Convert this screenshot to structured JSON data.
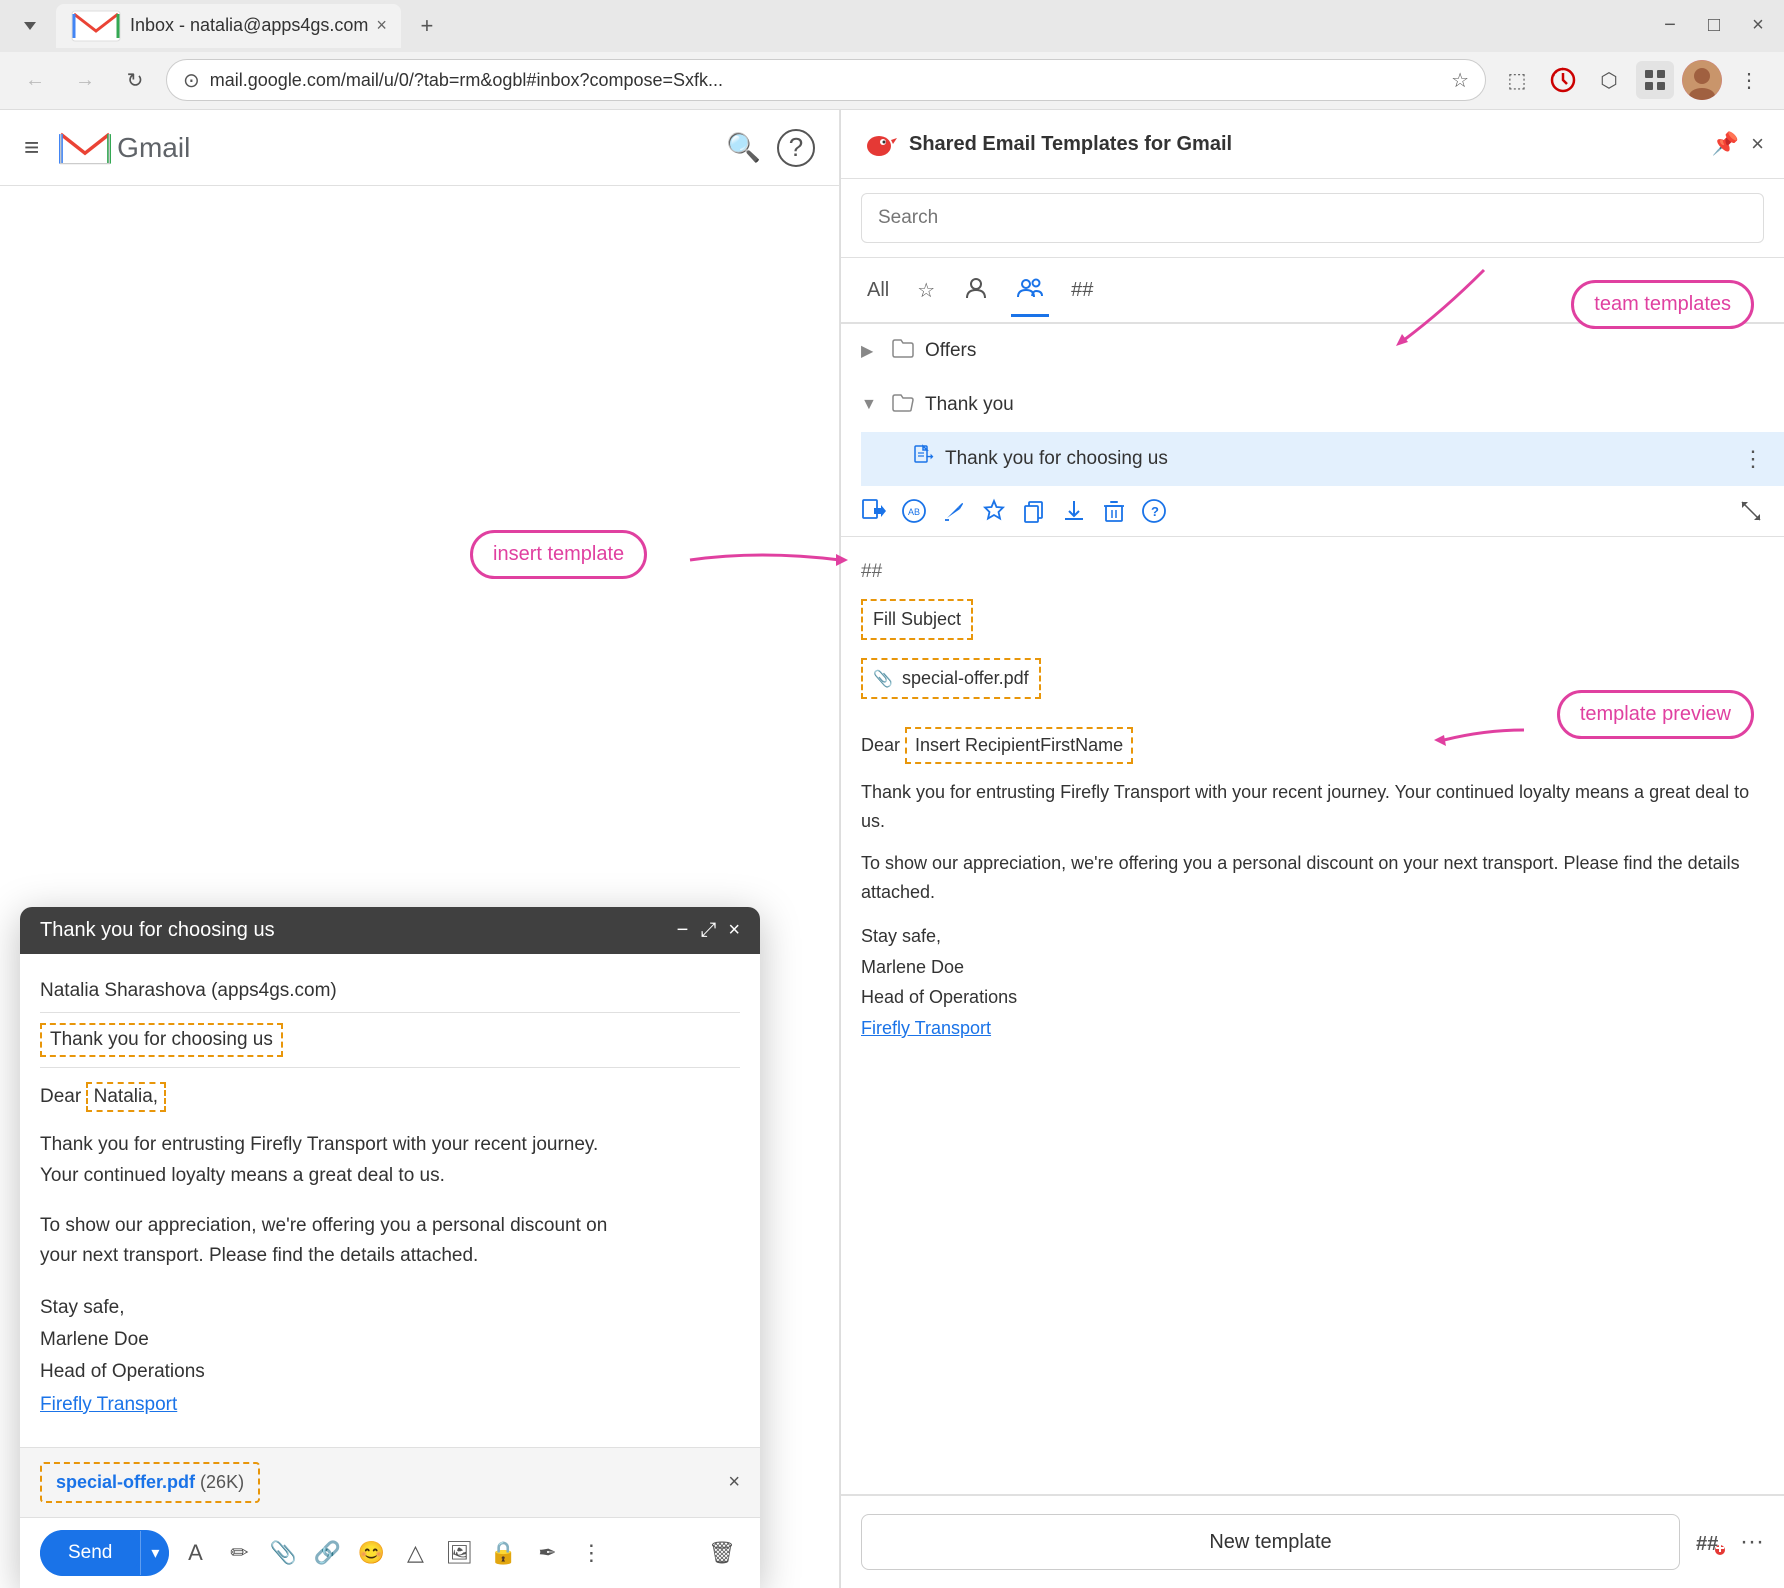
{
  "browser": {
    "tab_title": "Inbox - natalia@apps4gs.com",
    "tab_close": "×",
    "tab_new": "+",
    "url": "mail.google.com/mail/u/0/?tab=rm&ogbl#inbox?compose=Sxfk...",
    "back_icon": "←",
    "forward_icon": "→",
    "refresh_icon": "↻",
    "address_icon": "⊙",
    "bookmark_icon": "☆",
    "cast_icon": "⬚",
    "extensions_icon": "⬡",
    "more_icon": "⋮",
    "window_min": "−",
    "window_max": "□",
    "window_close": "×"
  },
  "gmail": {
    "header": {
      "hamburger": "≡",
      "logo_text": "Gmail",
      "search_icon": "🔍",
      "help_icon": "?"
    }
  },
  "compose": {
    "title": "Thank you for choosing us",
    "minimize_icon": "−",
    "resize_icon": "⤢",
    "close_icon": "×",
    "from": "Natalia Sharashova (apps4gs.com)",
    "subject": "Thank you for choosing us",
    "greeting": "Dear",
    "name_highlight": "Natalia,",
    "body_1": "Thank you for entrusting Firefly Transport with your recent journey.\nYour continued loyalty means a great deal to us.",
    "body_2": "To show our appreciation, we're offering you a personal discount on\nyour next transport. Please find the details attached.",
    "sig_1": "Stay safe,",
    "sig_2": "Marlene Doe",
    "sig_3": "Head of Operations",
    "sig_link": "Firefly Transport",
    "attachment_name": "special-offer.pdf",
    "attachment_size": "(26K)",
    "send_label": "Send",
    "toolbar": {
      "format_icon": "A",
      "highlight_icon": "✏",
      "clip_icon": "📎",
      "link_icon": "🔗",
      "emoji_icon": "😊",
      "drive_icon": "△",
      "image_icon": "🖼",
      "lock_icon": "🔒",
      "pen_icon": "✒",
      "more_icon": "⋮",
      "delete_icon": "🗑"
    }
  },
  "extension": {
    "header": {
      "title": "Shared Email Templates for Gmail",
      "pin_icon": "📌",
      "close_icon": "×"
    },
    "search": {
      "placeholder": "Search"
    },
    "tabs": {
      "all_label": "All",
      "starred_icon": "☆",
      "person_icon": "👤",
      "team_icon": "👥",
      "hash_icon": "##"
    },
    "tree": {
      "folders": [
        {
          "name": "Offers",
          "expanded": false,
          "items": []
        },
        {
          "name": "Thank you",
          "expanded": true,
          "items": [
            {
              "name": "Thank you for choosing us",
              "selected": true
            }
          ]
        }
      ]
    },
    "actions": {
      "insert_icon": "insert",
      "ab_test_icon": "ab",
      "edit_icon": "edit",
      "star_icon": "star",
      "copy_icon": "copy",
      "download_icon": "download",
      "delete_icon": "delete",
      "help_icon": "help",
      "expand_icon": "expand"
    },
    "preview": {
      "hash": "##",
      "subject_placeholder": "Fill Subject",
      "attachment_icon": "📎",
      "attachment_name": "special-offer.pdf",
      "dear": "Dear",
      "recipient_placeholder": "Insert RecipientFirstName",
      "body_1": "Thank you for entrusting Firefly Transport with your recent journey. Your continued loyalty means a great deal to us.",
      "body_2": "To show our appreciation, we're offering you a personal discount on your next transport. Please find the details attached.",
      "sig_1": "Stay safe,",
      "sig_2": "Marlene Doe",
      "sig_3": "Head of Operations",
      "sig_link": "Firefly Transport"
    },
    "footer": {
      "new_template_label": "New template",
      "hash_label": "##",
      "more_icon": "···"
    }
  },
  "callouts": {
    "team_templates": "team templates",
    "insert_template": "insert template",
    "template_preview": "template preview"
  }
}
